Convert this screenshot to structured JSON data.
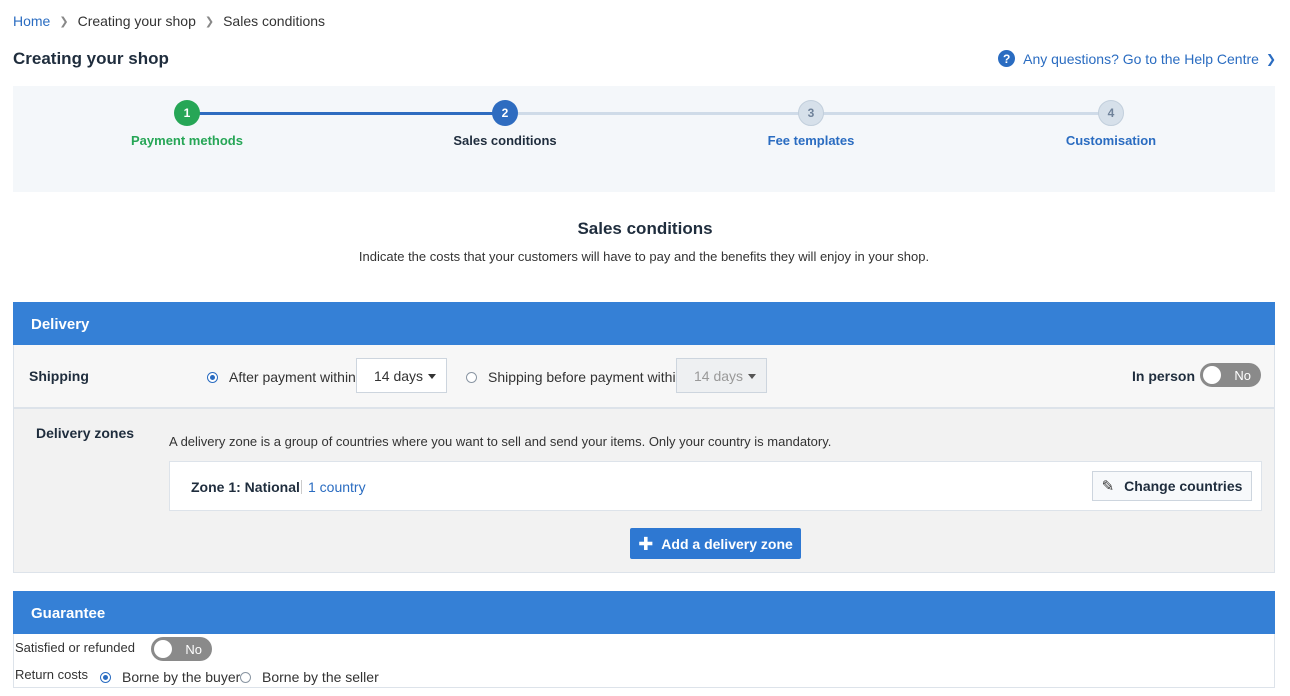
{
  "breadcrumb": {
    "home": "Home",
    "parent": "Creating your shop",
    "current": "Sales conditions"
  },
  "page": {
    "title": "Creating your shop",
    "help_link": "Any questions? Go to the Help Centre"
  },
  "steps": [
    {
      "number": "1",
      "label": "Payment methods",
      "state": "completed"
    },
    {
      "number": "2",
      "label": "Sales conditions",
      "state": "active"
    },
    {
      "number": "3",
      "label": "Fee templates",
      "state": "pending"
    },
    {
      "number": "4",
      "label": "Customisation",
      "state": "pending"
    }
  ],
  "section": {
    "title": "Sales conditions",
    "subtitle": "Indicate the costs that your customers will have to pay and the benefits they will enjoy in your shop."
  },
  "delivery": {
    "header": "Delivery",
    "shipping_label": "Shipping",
    "option_after": "After payment within",
    "option_after_selected": true,
    "after_days": "14 days",
    "option_before": "Shipping before payment within",
    "before_days": "14 days",
    "in_person_label": "In person",
    "in_person_toggle": "No",
    "zones_label": "Delivery zones",
    "zones_desc": "A delivery zone is a group of countries where you want to sell and send your items. Only your country is mandatory.",
    "zone": {
      "name": "Zone 1: National",
      "count": "1 country",
      "change_button": "Change countries"
    },
    "add_zone_button": "Add a delivery zone"
  },
  "guarantee": {
    "header": "Guarantee",
    "satisfied_label": "Satisfied or refunded",
    "satisfied_toggle": "No",
    "return_label": "Return costs",
    "option_buyer": "Borne by the buyer",
    "option_seller": "Borne by the seller"
  },
  "colors": {
    "primary": "#3580d6",
    "success": "#26a656",
    "link": "#2a6cc1"
  },
  "icons": {
    "help": "question-circle-icon",
    "edit": "pencil-icon",
    "add": "plus-icon"
  }
}
